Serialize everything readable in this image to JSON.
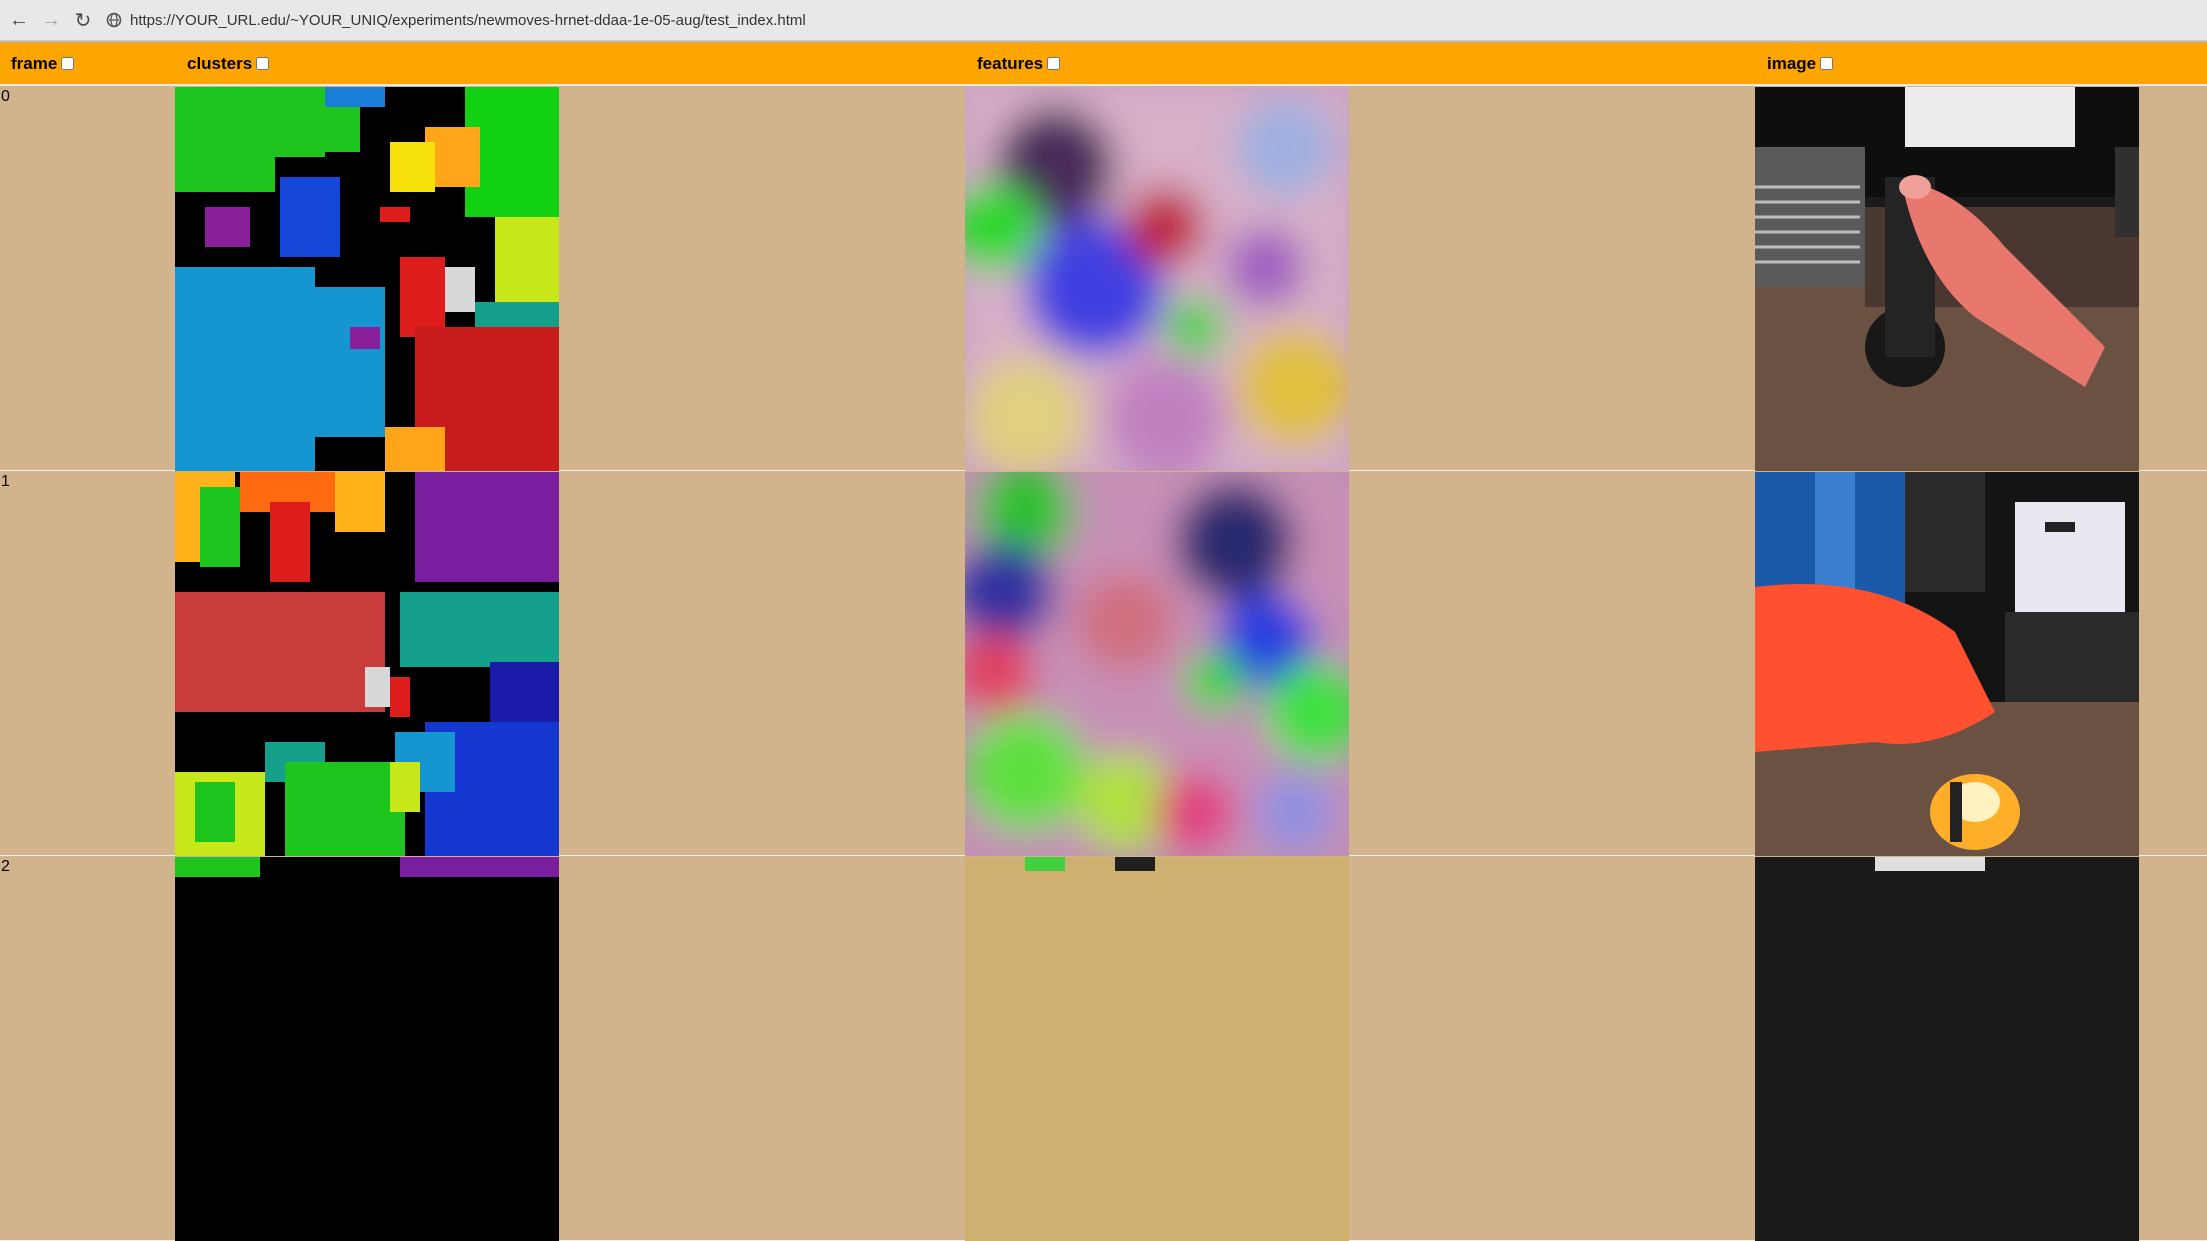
{
  "browser": {
    "url": "https://YOUR_URL.edu/~YOUR_UNIQ/experiments/newmoves-hrnet-ddaa-1e-05-aug/test_index.html",
    "back_icon": "arrow-left-icon",
    "forward_icon": "arrow-right-icon",
    "reload_icon": "reload-icon",
    "site_info_icon": "site-info-icon"
  },
  "header": {
    "frame": "frame",
    "clusters": "clusters",
    "features": "features",
    "image": "image"
  },
  "rows": [
    {
      "frame": "0"
    },
    {
      "frame": "1"
    },
    {
      "frame": "2"
    }
  ],
  "colors": {
    "page_background": "#d2b48c",
    "header_background": "#ffa500"
  }
}
